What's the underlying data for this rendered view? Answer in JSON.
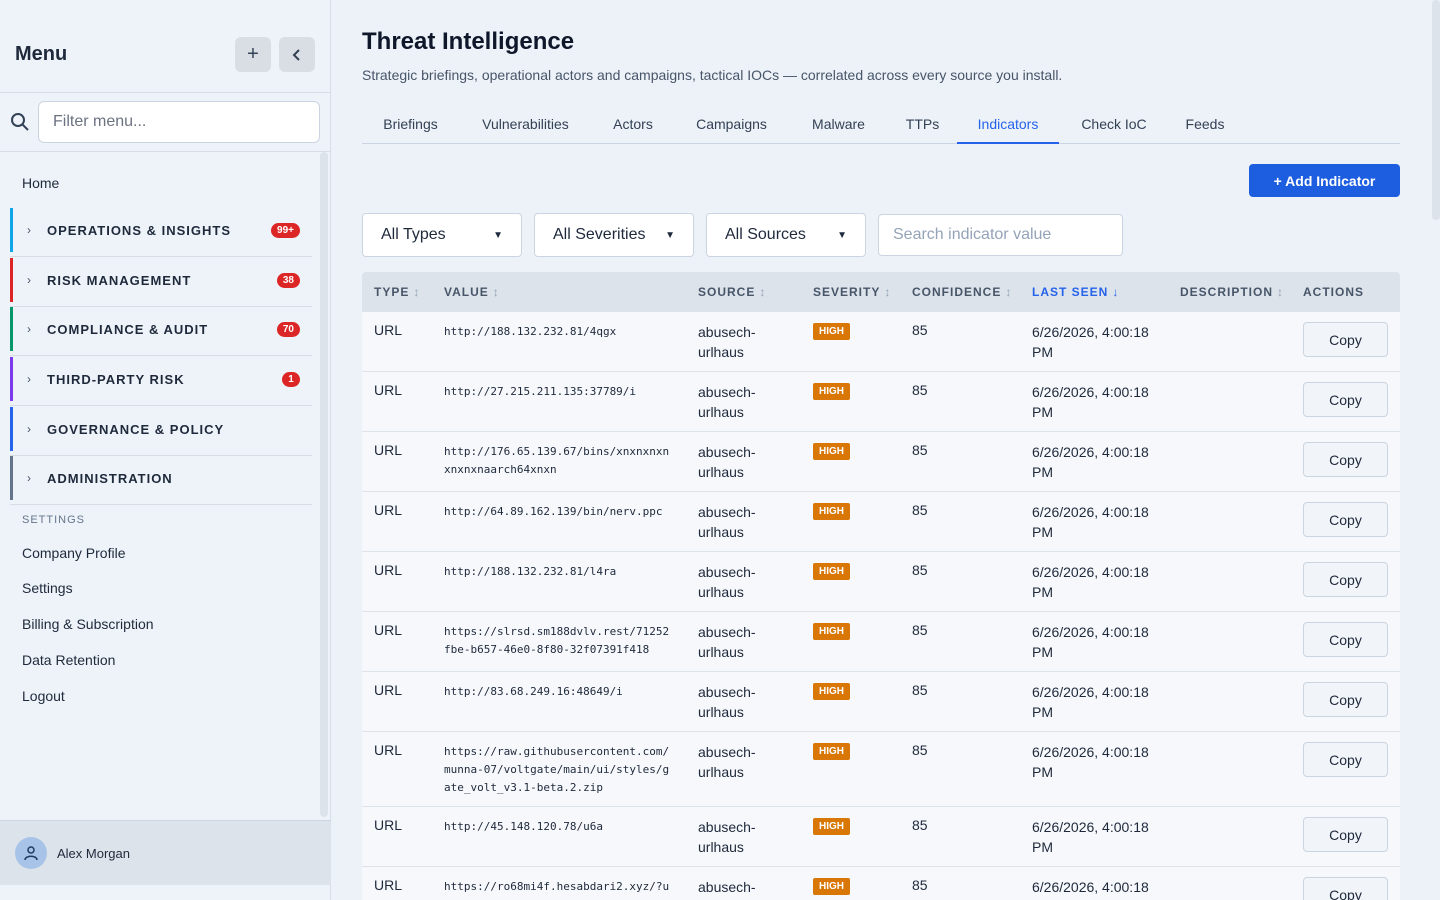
{
  "sidebar": {
    "title": "Menu",
    "filter_placeholder": "Filter menu...",
    "home": "Home",
    "groups": [
      {
        "label": "OPERATIONS & INSIGHTS",
        "badge": "99+",
        "color": "#0ea5e9"
      },
      {
        "label": "RISK MANAGEMENT",
        "badge": "38",
        "color": "#dc2626"
      },
      {
        "label": "COMPLIANCE & AUDIT",
        "badge": "70",
        "color": "#059669"
      },
      {
        "label": "THIRD-PARTY RISK",
        "badge": "1",
        "color": "#7c3aed"
      },
      {
        "label": "GOVERNANCE & POLICY",
        "badge": "",
        "color": "#2563eb"
      },
      {
        "label": "ADMINISTRATION",
        "badge": "",
        "color": "#64748b"
      }
    ],
    "settings_heading": "SETTINGS",
    "settings_links": [
      "Company Profile",
      "Settings",
      "Billing & Subscription",
      "Data Retention",
      "Logout"
    ],
    "user_name": "Alex Morgan"
  },
  "page": {
    "title": "Threat Intelligence",
    "subtitle": "Strategic briefings, operational actors and campaigns, tactical IOCs — correlated across every source you install."
  },
  "tabs": [
    "Briefings",
    "Vulnerabilities",
    "Actors",
    "Campaigns",
    "Malware",
    "TTPs",
    "Indicators",
    "Check IoC",
    "Feeds"
  ],
  "active_tab": "Indicators",
  "add_button": "+ Add Indicator",
  "filters": {
    "type": "All Types",
    "severity": "All Severities",
    "source": "All Sources",
    "search_placeholder": "Search indicator value"
  },
  "table": {
    "headers": [
      "TYPE",
      "VALUE",
      "SOURCE",
      "SEVERITY",
      "CONFIDENCE",
      "LAST SEEN",
      "DESCRIPTION",
      "ACTIONS"
    ],
    "sort_icon": "↕",
    "active_sort_icon": "↓",
    "rows": [
      {
        "type": "URL",
        "value": "http://188.132.232.81/4qgx",
        "source": "abusech-urlhaus",
        "severity": "HIGH",
        "confidence": "85",
        "last_seen": "6/26/2026, 4:00:18 PM",
        "description": "",
        "action": "Copy"
      },
      {
        "type": "URL",
        "value": "http://27.215.211.135:37789/i",
        "source": "abusech-urlhaus",
        "severity": "HIGH",
        "confidence": "85",
        "last_seen": "6/26/2026, 4:00:18 PM",
        "description": "",
        "action": "Copy"
      },
      {
        "type": "URL",
        "value": "http://176.65.139.67/bins/xnxnxnxnxnxnxnaarch64xnxn",
        "source": "abusech-urlhaus",
        "severity": "HIGH",
        "confidence": "85",
        "last_seen": "6/26/2026, 4:00:18 PM",
        "description": "",
        "action": "Copy"
      },
      {
        "type": "URL",
        "value": "http://64.89.162.139/bin/nerv.ppc",
        "source": "abusech-urlhaus",
        "severity": "HIGH",
        "confidence": "85",
        "last_seen": "6/26/2026, 4:00:18 PM",
        "description": "",
        "action": "Copy"
      },
      {
        "type": "URL",
        "value": "http://188.132.232.81/l4ra",
        "source": "abusech-urlhaus",
        "severity": "HIGH",
        "confidence": "85",
        "last_seen": "6/26/2026, 4:00:18 PM",
        "description": "",
        "action": "Copy"
      },
      {
        "type": "URL",
        "value": "https://slrsd.sm188dvlv.rest/71252fbe-b657-46e0-8f80-32f07391f418",
        "source": "abusech-urlhaus",
        "severity": "HIGH",
        "confidence": "85",
        "last_seen": "6/26/2026, 4:00:18 PM",
        "description": "",
        "action": "Copy"
      },
      {
        "type": "URL",
        "value": "http://83.68.249.16:48649/i",
        "source": "abusech-urlhaus",
        "severity": "HIGH",
        "confidence": "85",
        "last_seen": "6/26/2026, 4:00:18 PM",
        "description": "",
        "action": "Copy"
      },
      {
        "type": "URL",
        "value": "https://raw.githubusercontent.com/munna-07/voltgate/main/ui/styles/gate_volt_v3.1-beta.2.zip",
        "source": "abusech-urlhaus",
        "severity": "HIGH",
        "confidence": "85",
        "last_seen": "6/26/2026, 4:00:18 PM",
        "description": "",
        "action": "Copy"
      },
      {
        "type": "URL",
        "value": "http://45.148.120.78/u6a",
        "source": "abusech-urlhaus",
        "severity": "HIGH",
        "confidence": "85",
        "last_seen": "6/26/2026, 4:00:18 PM",
        "description": "",
        "action": "Copy"
      },
      {
        "type": "URL",
        "value": "https://ro68mi4f.hesabdari2.xyz/?u",
        "source": "abusech-",
        "severity": "HIGH",
        "confidence": "85",
        "last_seen": "6/26/2026, 4:00:18",
        "description": "",
        "action": "Copy"
      }
    ]
  },
  "colors": {
    "accent": "#2563eb",
    "severity_high": "#d97706",
    "badge": "#dc2626"
  }
}
